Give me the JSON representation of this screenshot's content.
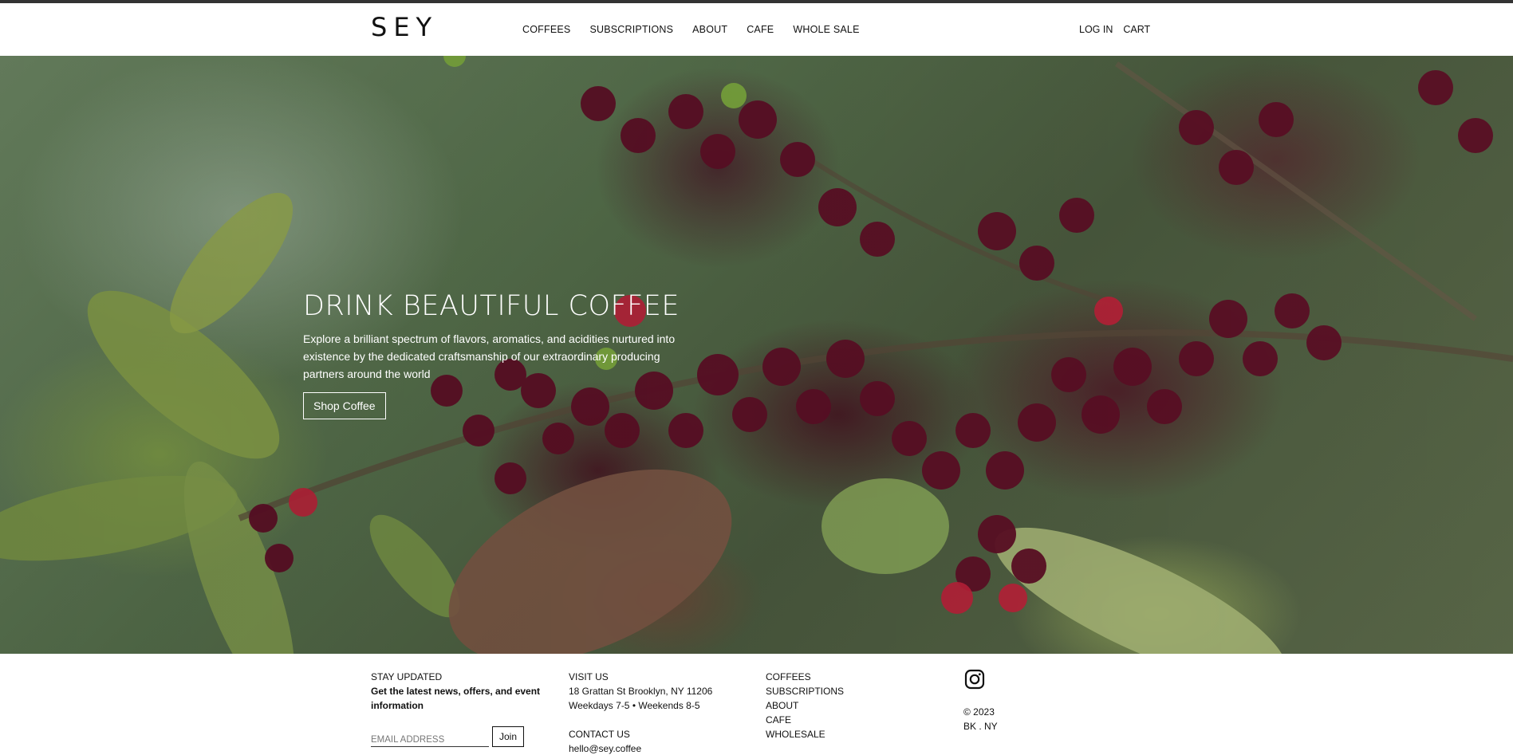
{
  "header": {
    "logo": "SEY",
    "nav": [
      "COFFEES",
      "SUBSCRIPTIONS",
      "ABOUT",
      "CAFE",
      "WHOLE SALE"
    ],
    "right": [
      "LOG IN",
      "CART"
    ]
  },
  "hero": {
    "title": "DRINK BEAUTIFUL COFFEE",
    "text": "Explore a brilliant spectrum of flavors, aromatics, and acidities nurtured into existence by the dedicated craftsmanship of our extraordinary producing partners around the world",
    "button": "Shop Coffee"
  },
  "footer": {
    "newsletter": {
      "label": "STAY UPDATED",
      "tagline": "Get the latest news, offers, and event information",
      "placeholder": "EMAIL ADDRESS",
      "button": "Join"
    },
    "visit": {
      "label": "VISIT US",
      "address": "18 Grattan St Brooklyn, NY 11206",
      "hours": "Weekdays 7-5 • Weekends 8-5"
    },
    "contact": {
      "label": "CONTACT US",
      "email": "hello@sey.coffee"
    },
    "links": [
      "COFFEES",
      "SUBSCRIPTIONS",
      "ABOUT",
      "CAFE",
      "WHOLESALE"
    ],
    "social_icon": "instagram-icon",
    "copyright": "© 2023",
    "location": "BK . NY"
  }
}
